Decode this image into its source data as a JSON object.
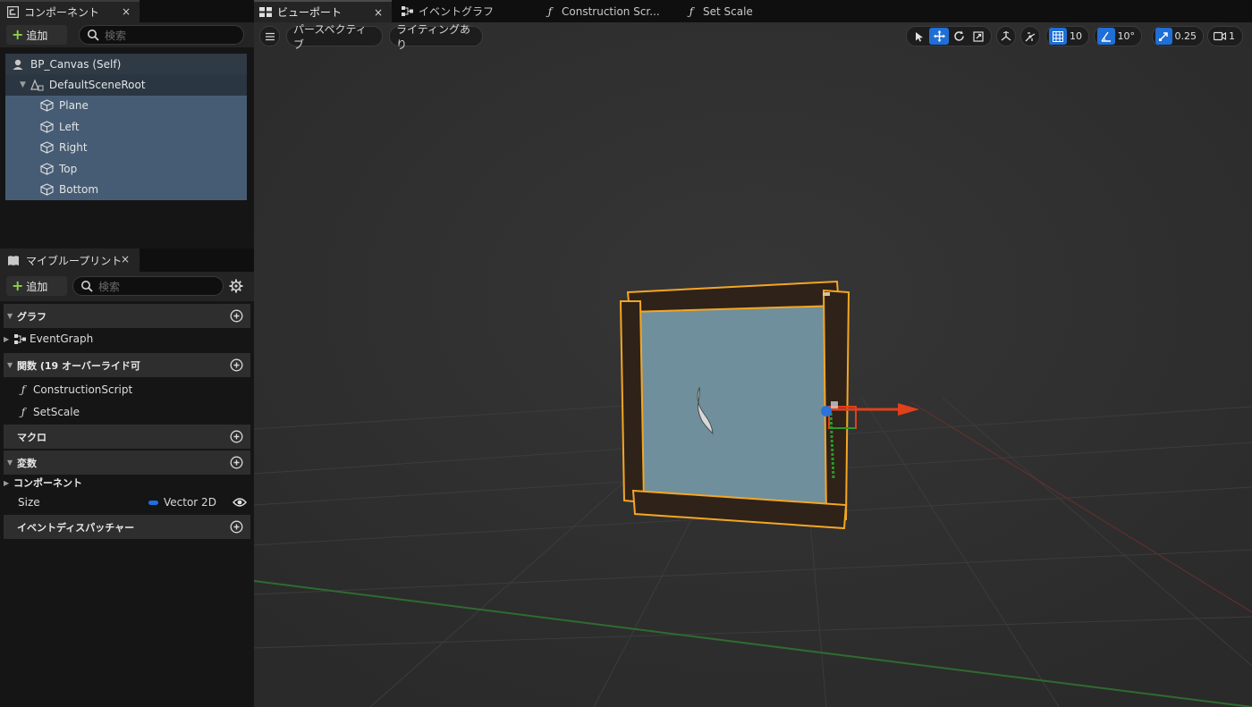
{
  "components_panel": {
    "tab_title": "コンポーネント",
    "close": "×",
    "add_label": "追加",
    "search_placeholder": "検索",
    "tree": [
      {
        "label": "BP_Canvas (Self)"
      },
      {
        "label": "DefaultSceneRoot"
      },
      {
        "label": "Plane"
      },
      {
        "label": "Left"
      },
      {
        "label": "Right"
      },
      {
        "label": "Top"
      },
      {
        "label": "Bottom"
      }
    ]
  },
  "my_blueprint": {
    "tab_title": "マイブループリント",
    "close": "×",
    "add_label": "追加",
    "search_placeholder": "検索",
    "sections": {
      "graphs": "グラフ",
      "event_graph": "EventGraph",
      "functions": "関数 (19 オーバーライド可",
      "construction_script": "ConstructionScript",
      "set_scale": "SetScale",
      "macros": "マクロ",
      "variables": "変数",
      "components_cat": "コンポーネント",
      "var_size_name": "Size",
      "var_size_type": "Vector 2D",
      "event_dispatchers": "イベントディスパッチャー"
    }
  },
  "doc_tabs": [
    {
      "label": "ビューポート",
      "close": "×"
    },
    {
      "label": "イベントグラフ"
    },
    {
      "label": "Construction Scr..."
    },
    {
      "label": "Set Scale"
    }
  ],
  "viewport_toolbar": {
    "perspective": "パースペクティブ",
    "lighting": "ライティングあり",
    "grid_snap": "10",
    "rotation_snap": "10°",
    "scale_snap": "0.25",
    "camera_speed": "1"
  },
  "colors": {
    "selection_outline": "#f5a623",
    "accent_blue": "#1f6fd6",
    "tree_selected": "#465c74",
    "canvas_plane": "#6f8f9c",
    "frame_wood": "#2e2219"
  }
}
